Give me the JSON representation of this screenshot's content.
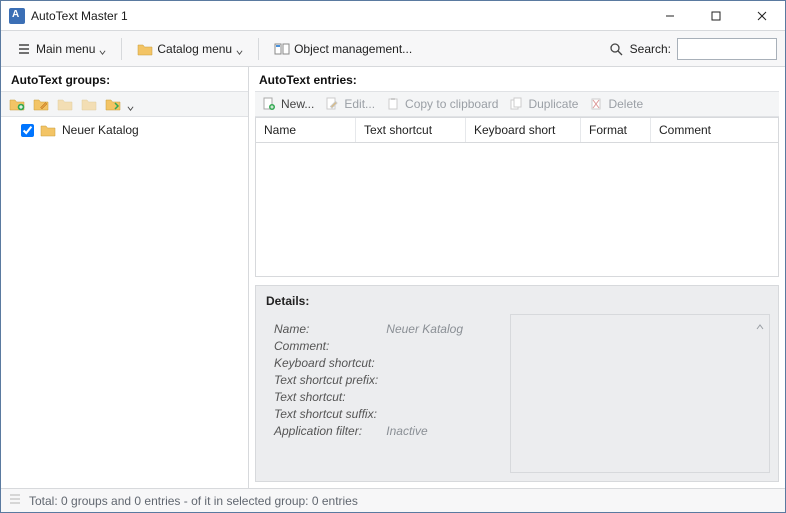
{
  "window": {
    "title": "AutoText Master 1"
  },
  "toolbar": {
    "main_menu": "Main menu",
    "catalog_menu": "Catalog menu",
    "object_mgmt": "Object management...",
    "search_label": "Search:",
    "search_placeholder": ""
  },
  "left": {
    "header": "AutoText groups:",
    "tree": {
      "item0_label": "Neuer Katalog",
      "item0_checked": true
    }
  },
  "right": {
    "header": "AutoText entries:",
    "entry_toolbar": {
      "new": "New...",
      "edit": "Edit...",
      "copy": "Copy to clipboard",
      "duplicate": "Duplicate",
      "delete": "Delete"
    },
    "columns": {
      "name": "Name",
      "text_shortcut": "Text shortcut",
      "keyboard_short": "Keyboard short",
      "format": "Format",
      "comment": "Comment"
    }
  },
  "details": {
    "title": "Details:",
    "labels": {
      "name": "Name:",
      "comment": "Comment:",
      "keyboard_shortcut": "Keyboard shortcut:",
      "text_shortcut_prefix": "Text shortcut prefix:",
      "text_shortcut": "Text shortcut:",
      "text_shortcut_suffix": "Text shortcut suffix:",
      "application_filter": "Application filter:"
    },
    "values": {
      "name": "Neuer Katalog",
      "comment": "",
      "keyboard_shortcut": "",
      "text_shortcut_prefix": "",
      "text_shortcut": "",
      "text_shortcut_suffix": "",
      "application_filter": "Inactive"
    }
  },
  "status": {
    "text": "Total: 0 groups and 0 entries - of it in selected group: 0 entries"
  }
}
